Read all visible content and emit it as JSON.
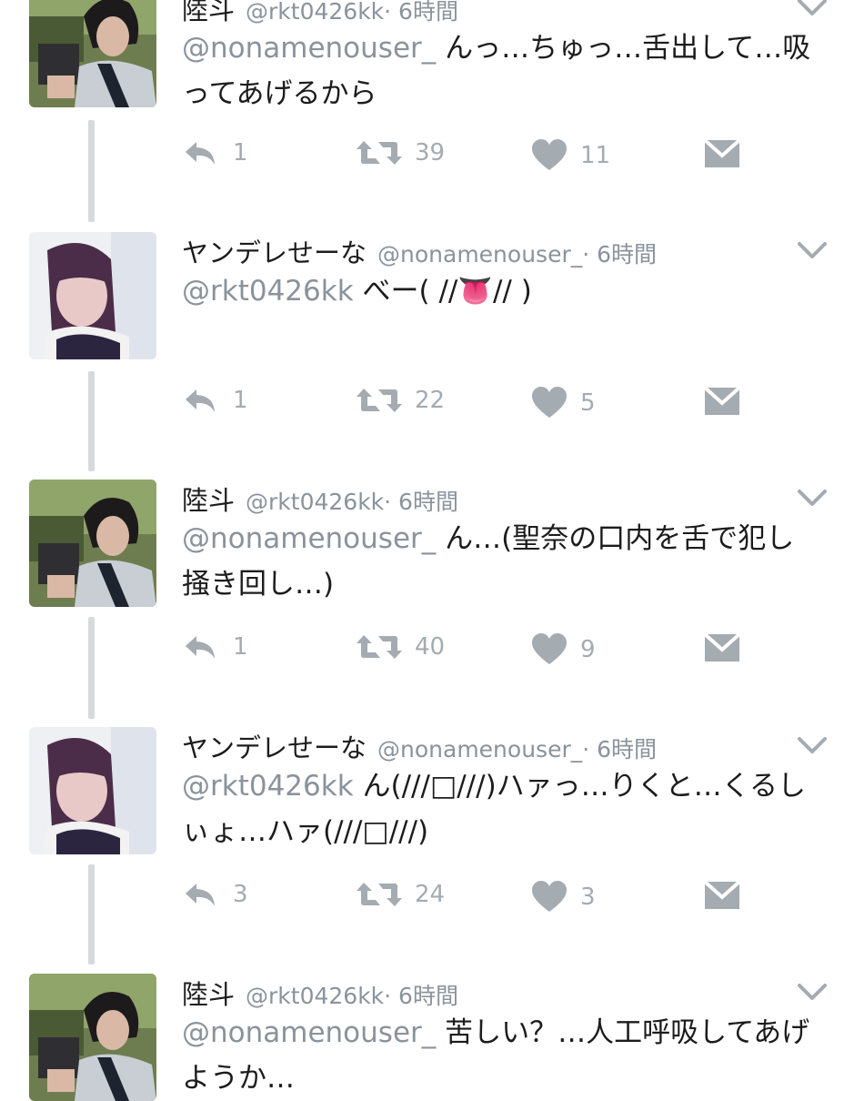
{
  "tweets": [
    {
      "name": "陸斗",
      "handle": "@rkt0426kk",
      "time": "· 6時間",
      "mention": "@nonamenouser_",
      "text": "んっ…ちゅっ…舌出して…吸ってあげるから",
      "replies": "1",
      "retweets": "39",
      "likes": "11"
    },
    {
      "name": "ヤンデレせーな",
      "handle": "@nonamenouser_",
      "time": "· 6時間",
      "mention": "@rkt0426kk",
      "text": "べー( //👅// )",
      "replies": "1",
      "retweets": "22",
      "likes": "5"
    },
    {
      "name": "陸斗",
      "handle": "@rkt0426kk",
      "time": "· 6時間",
      "mention": "@nonamenouser_",
      "text": "ん…(聖奈の口内を舌で犯し掻き回し…)",
      "replies": "1",
      "retweets": "40",
      "likes": "9"
    },
    {
      "name": "ヤンデレせーな",
      "handle": "@nonamenouser_",
      "time": "· 6時間",
      "mention": "@rkt0426kk",
      "text": "ん(///□///)ハァっ…りくと…くるしぃょ…ハァ(///□///)",
      "replies": "3",
      "retweets": "24",
      "likes": "3"
    },
    {
      "name": "陸斗",
      "handle": "@rkt0426kk",
      "time": "· 6時間",
      "mention": "@nonamenouser_",
      "text": "苦しい？…人工呼吸してあげようか…"
    }
  ],
  "avatar_badge": "SKY",
  "icons": {
    "reply": "reply-arrow-icon",
    "retweet": "retweet-icon",
    "like": "heart-icon",
    "dm": "envelope-icon",
    "more": "chevron-down-icon"
  },
  "colors": {
    "muted": "#8a939b",
    "action_gray": "#a4abb1",
    "thread_line": "#d5dadd",
    "text": "#1c1c1c"
  }
}
